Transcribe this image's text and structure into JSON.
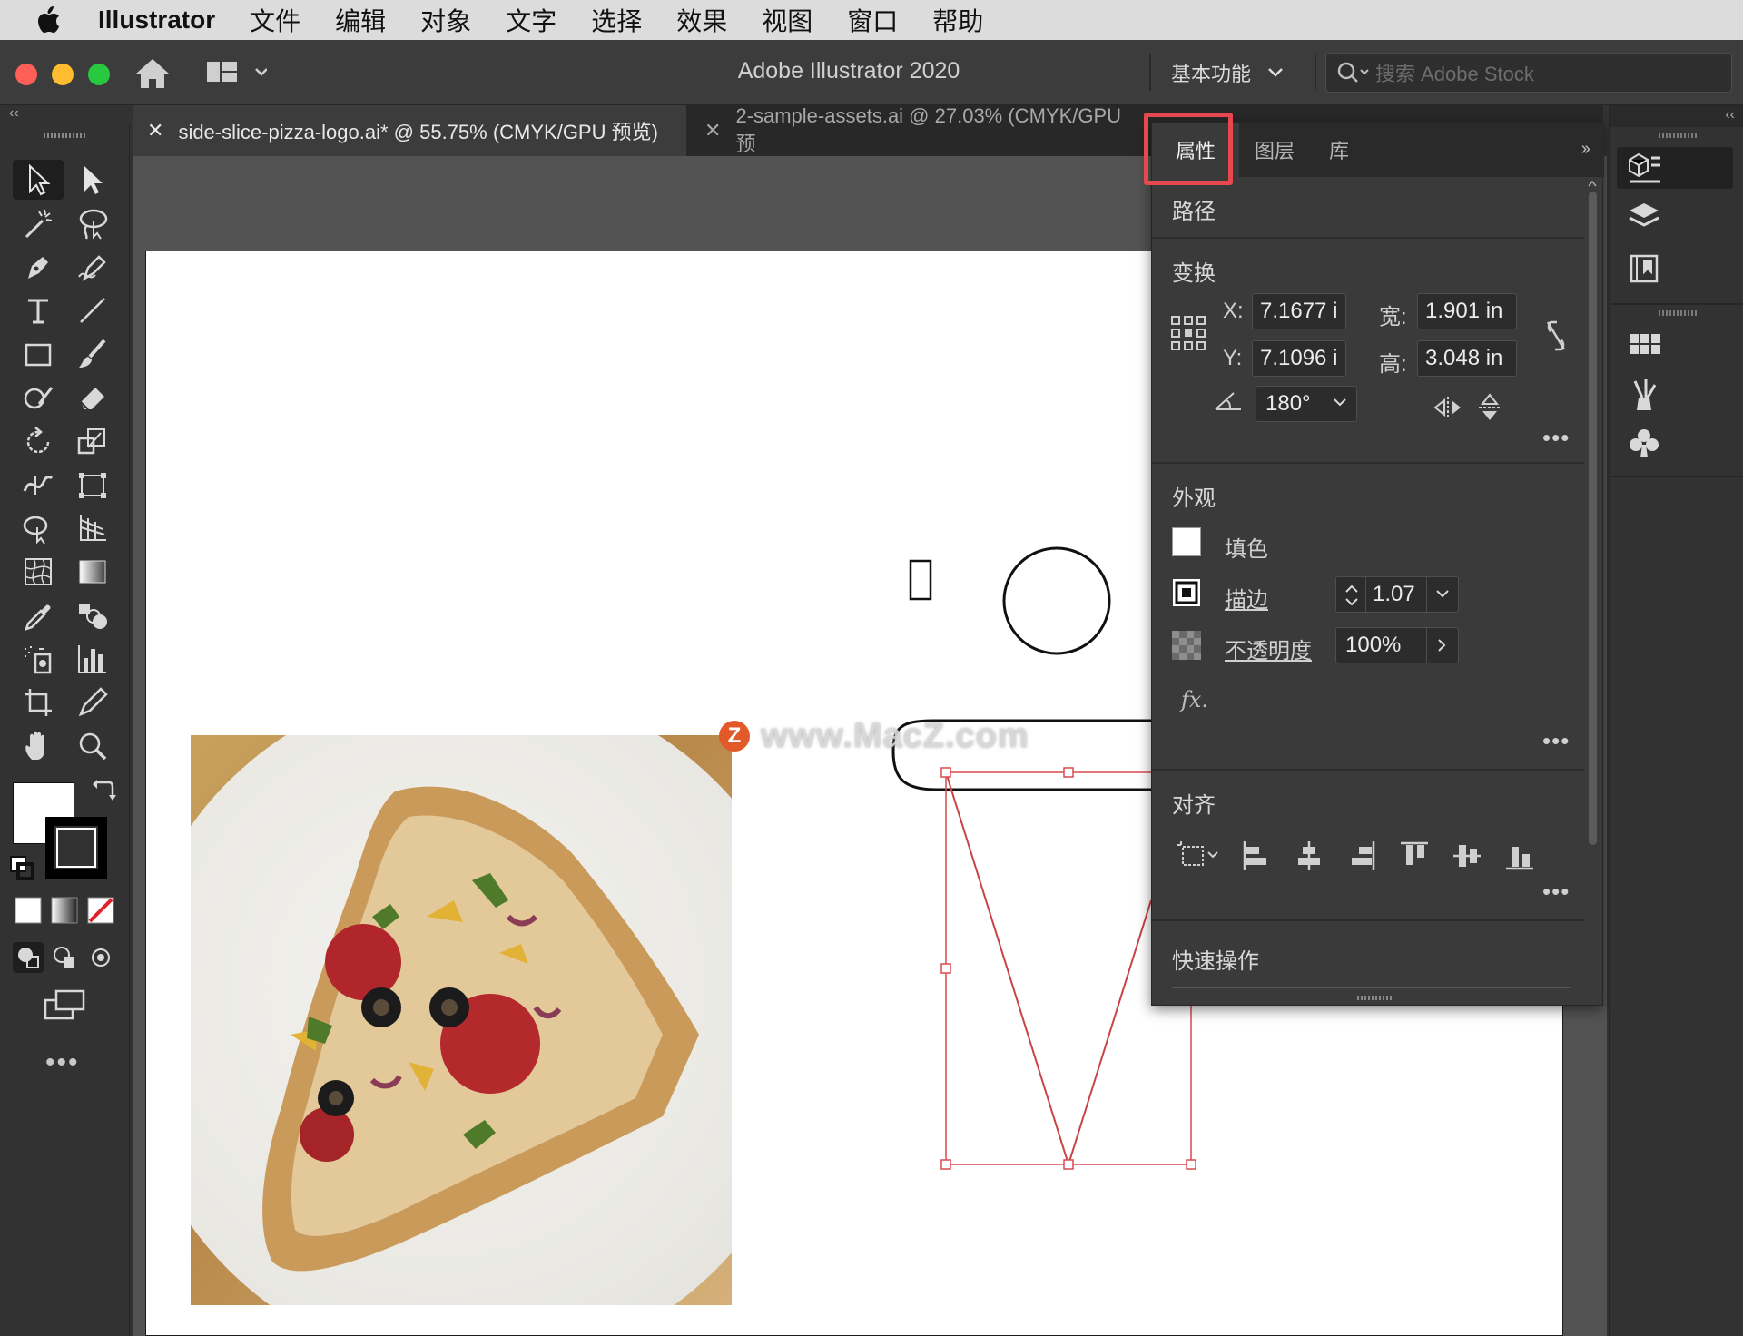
{
  "menubar": {
    "app_name": "Illustrator",
    "items": [
      "文件",
      "编辑",
      "对象",
      "文字",
      "选择",
      "效果",
      "视图",
      "窗口",
      "帮助"
    ]
  },
  "titlebar": {
    "title": "Adobe Illustrator 2020",
    "workspace": "基本功能",
    "stock_search_placeholder": "搜索 Adobe Stock"
  },
  "tabs": [
    {
      "label": "side-slice-pizza-logo.ai* @ 55.75% (CMYK/GPU 预览)",
      "active": true
    },
    {
      "label": "2-sample-assets.ai @ 27.03% (CMYK/GPU 预",
      "active": false
    }
  ],
  "panel": {
    "tabs": [
      "属性",
      "图层",
      "库"
    ],
    "selection_type": "路径",
    "transform": {
      "title": "变换",
      "x_label": "X:",
      "x_value": "7.1677 i",
      "y_label": "Y:",
      "y_value": "7.1096 i",
      "w_label": "宽:",
      "w_value": "1.901 in",
      "h_label": "高:",
      "h_value": "3.048 in",
      "angle_value": "180°"
    },
    "appearance": {
      "title": "外观",
      "fill_label": "填色",
      "stroke_label": "描边",
      "stroke_value": "1.07",
      "opacity_label": "不透明度",
      "opacity_value": "100%",
      "fx_label": "fx."
    },
    "align": {
      "title": "对齐"
    },
    "quick_actions": {
      "title": "快速操作"
    }
  },
  "canvas": {
    "watermark": "www.MacZ.com",
    "watermark_badge": "Z"
  },
  "colors": {
    "highlight": "#e7474e",
    "selection": "#d94a4f",
    "canvas": "#535353",
    "panel": "#3a3a3a"
  }
}
